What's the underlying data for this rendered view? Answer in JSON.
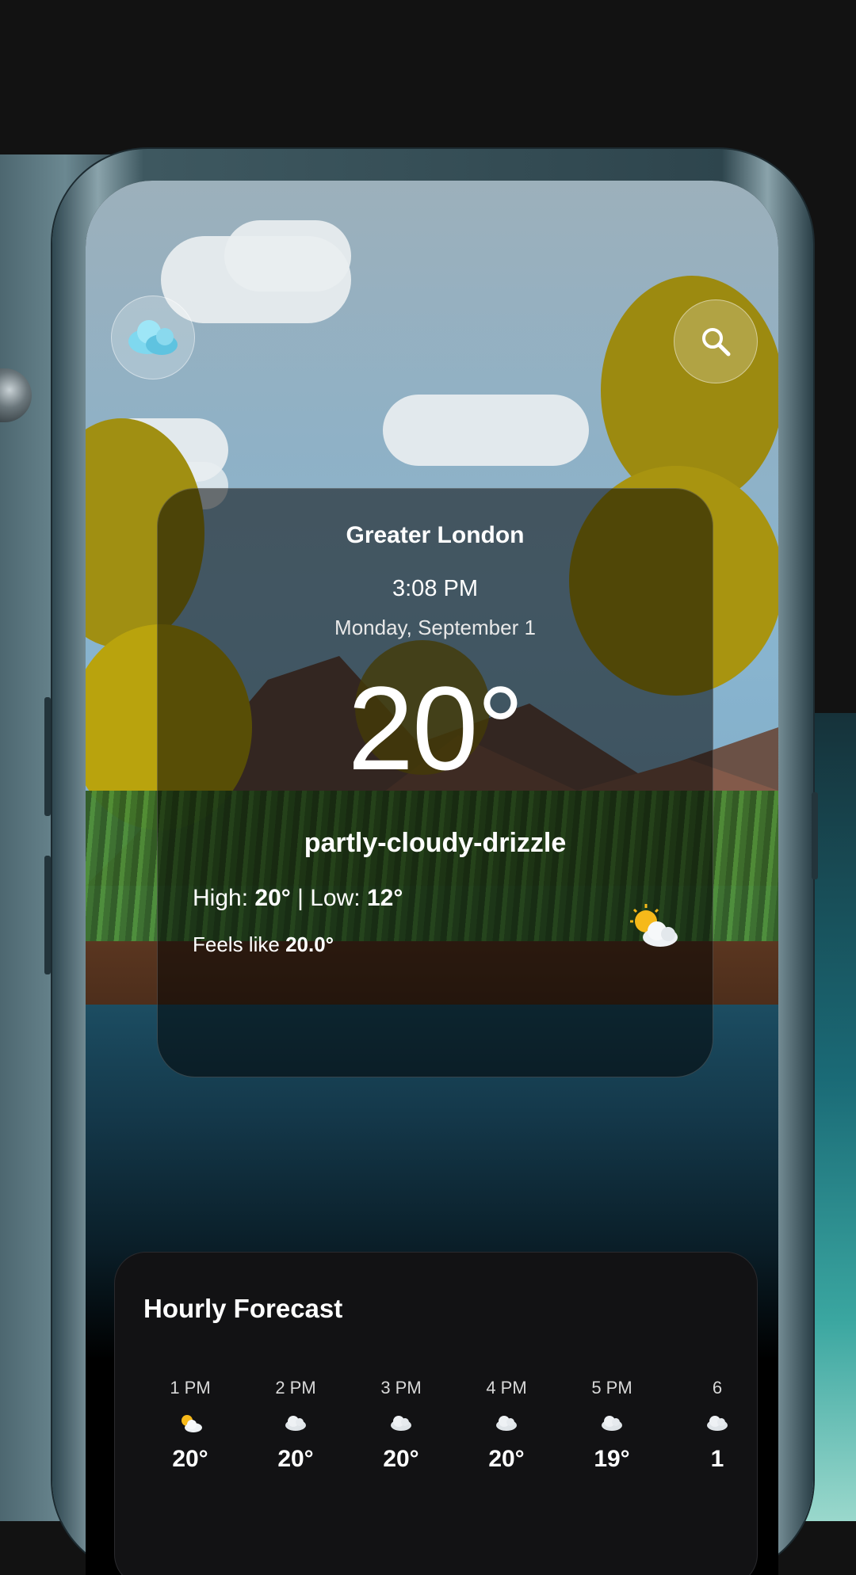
{
  "location": {
    "city": "Greater London",
    "time": "3:08 PM",
    "date": "Monday, September 1"
  },
  "current": {
    "temperature": "20°",
    "condition": "partly-cloudy-drizzle",
    "high_label": "High:",
    "high": "20°",
    "separator": "|",
    "low_label": "Low:",
    "low": "12°",
    "feels_label": "Feels like",
    "feels": "20.0°",
    "icon": "sun-behind-cloud-icon"
  },
  "header": {
    "logo_icon": "cloud-logo-icon",
    "search_icon": "search-icon"
  },
  "hourly": {
    "title": "Hourly Forecast",
    "items": [
      {
        "time": "1 PM",
        "icon": "sun-behind-cloud-icon",
        "temp": "20°"
      },
      {
        "time": "2 PM",
        "icon": "cloud-icon",
        "temp": "20°"
      },
      {
        "time": "3 PM",
        "icon": "cloud-icon",
        "temp": "20°"
      },
      {
        "time": "4 PM",
        "icon": "cloud-icon",
        "temp": "20°"
      },
      {
        "time": "5 PM",
        "icon": "cloud-icon",
        "temp": "19°"
      },
      {
        "time": "6",
        "icon": "cloud-icon",
        "temp": "1"
      }
    ]
  },
  "colors": {
    "card_bg": "rgba(0,0,0,0.52)",
    "panel_bg": "#121214",
    "text": "#ffffff"
  }
}
